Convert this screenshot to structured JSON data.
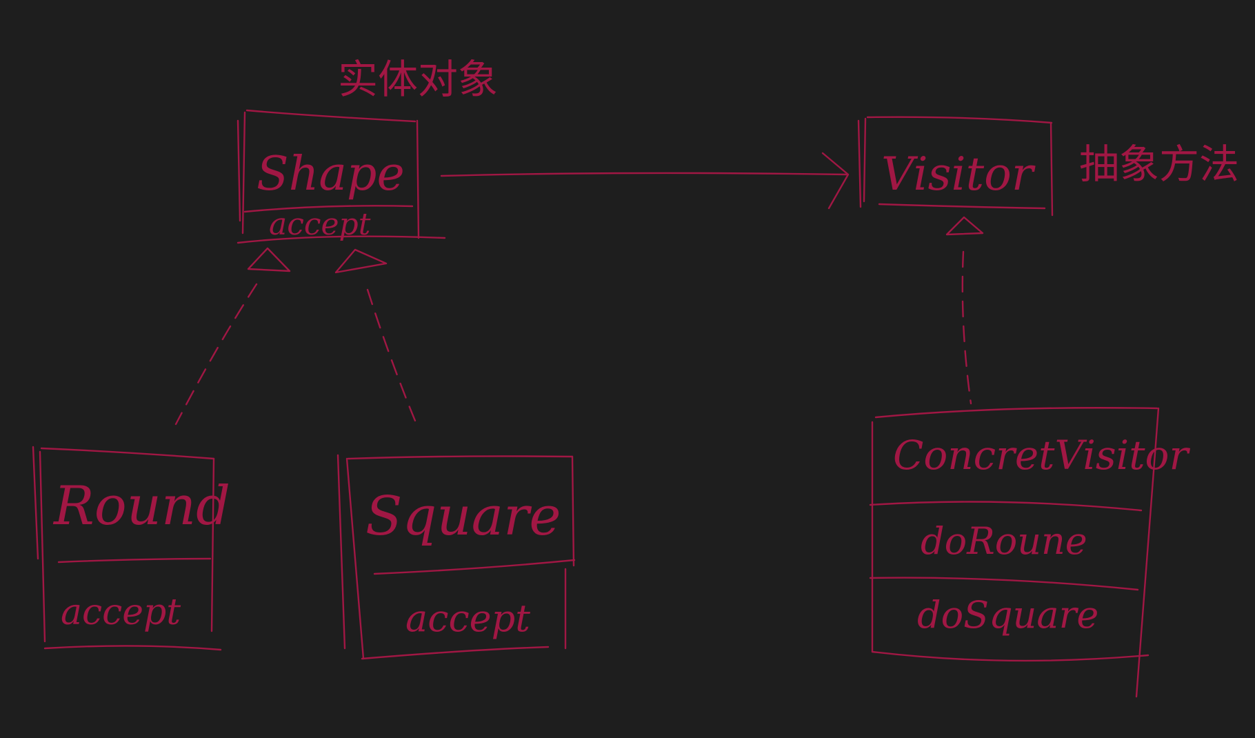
{
  "colors": {
    "background": "#1e1e1e",
    "ink": "#a11744"
  },
  "annotations": {
    "entity_label": "实体对象",
    "abstract_method_label": "抽象方法"
  },
  "classes": {
    "shape": {
      "name": "Shape",
      "method": "accept"
    },
    "visitor": {
      "name": "Visitor"
    },
    "round": {
      "name": "Round",
      "method": "accept"
    },
    "square": {
      "name": "Square",
      "method": "accept"
    },
    "concrete_visitor": {
      "name": "ConcretVisitor",
      "methods": [
        "doRoune",
        "doSquare"
      ]
    }
  }
}
